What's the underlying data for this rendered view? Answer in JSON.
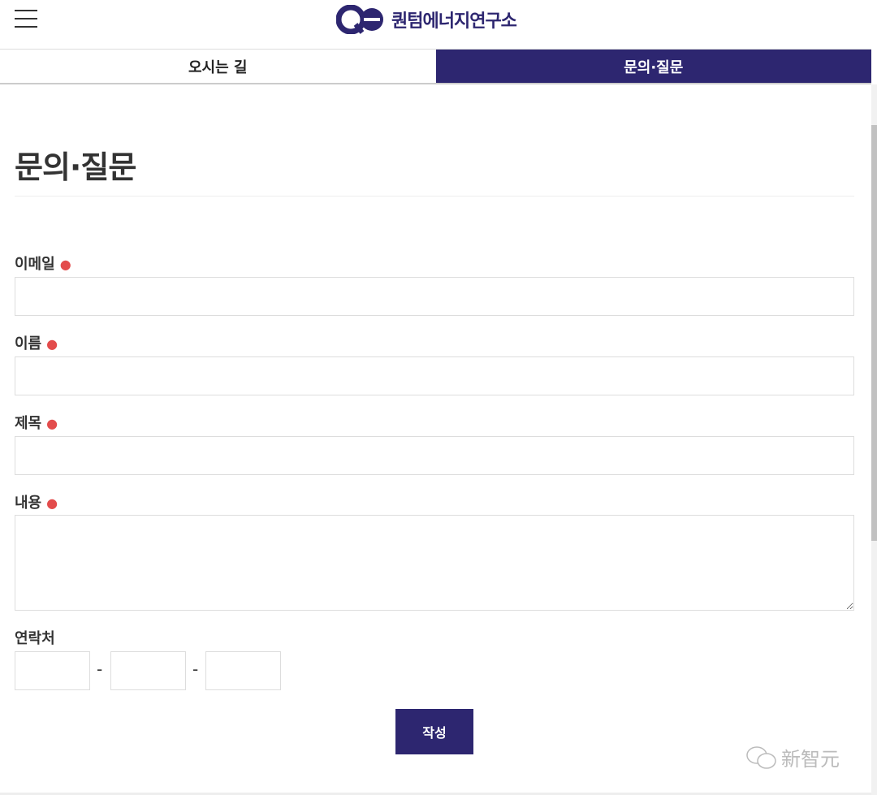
{
  "header": {
    "logo_text": "퀀텀에너지연구소",
    "logo_mark": "QE"
  },
  "tabs": [
    {
      "label": "오시는 길",
      "active": false
    },
    {
      "label": "문의·질문",
      "active": true
    }
  ],
  "page_title": "문의·질문",
  "form": {
    "email_label": "이메일",
    "name_label": "이름",
    "subject_label": "제목",
    "content_label": "내용",
    "phone_label": "연락처",
    "required_mark": "●",
    "phone_separator": "-",
    "submit_label": "작성"
  },
  "watermark": "新智元",
  "colors": {
    "brand": "#2d2670",
    "required": "#e34c4c"
  }
}
